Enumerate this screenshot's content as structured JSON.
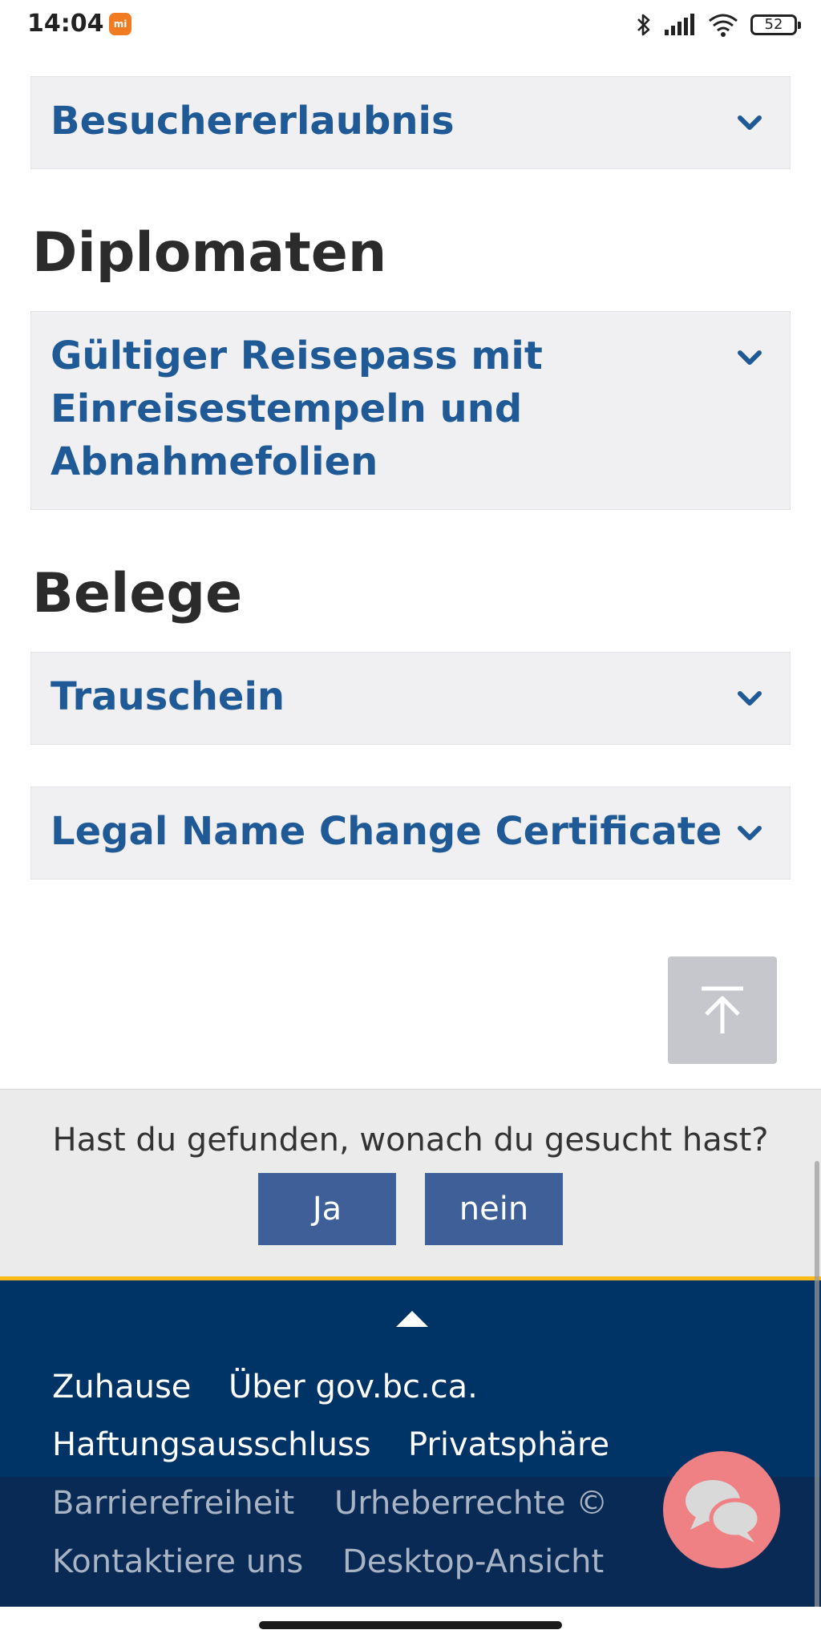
{
  "status_bar": {
    "time": "14:04",
    "app_icon": "mi-app-icon",
    "battery_level": "52",
    "icons": [
      "bluetooth-icon",
      "signal-icon",
      "wifi-icon",
      "battery-icon"
    ]
  },
  "sections": {
    "visitor_permit": {
      "label": "Besuchererlaubnis"
    },
    "diplomats": {
      "heading": "Diplomaten",
      "passport_line1": "Gültiger Reisepass mit",
      "passport_line2": "Einreisestempeln und",
      "passport_line3": "Abnahmefolien"
    },
    "documents": {
      "heading": "Belege",
      "marriage_certificate": "Trauschein",
      "name_change_certificate": "Legal Name Change Certificate"
    }
  },
  "feedback": {
    "question": "Hast du gefunden, wonach du gesucht hast?",
    "yes_label": "Ja",
    "no_label": "nein"
  },
  "footer": {
    "links": {
      "home": "Zuhause",
      "about": "Über gov.bc.ca.",
      "disclaimer": "Haftungsausschluss",
      "privacy": "Privatsphäre",
      "accessibility": "Barrierefreiheit",
      "copyright": "Urheberrechte ©",
      "contact": "Kontaktiere uns",
      "desktop_view": "Desktop-Ansicht"
    }
  },
  "colors": {
    "accordion_text": "#1f5a96",
    "accordion_bg": "#f0f0f3",
    "footer_bg": "#003366",
    "footer_accent": "#fcba19",
    "feedback_button": "#3e5f98",
    "chat_button": "#ef8084"
  }
}
